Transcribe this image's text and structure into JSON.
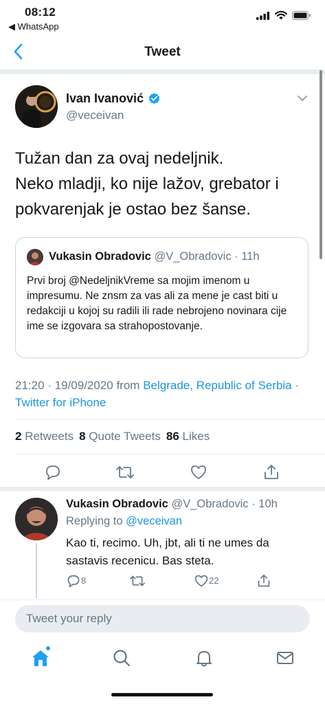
{
  "status": {
    "time": "08:12",
    "back_app": "◀ WhatsApp"
  },
  "nav": {
    "title": "Tweet",
    "back_icon": "chevron-left-icon"
  },
  "tweet": {
    "author_name": "Ivan Ivanović",
    "author_handle": "@veceivan",
    "verified": true,
    "text_lines": [
      "Tužan dan za ovaj nedeljnik.",
      "Neko mladji, ko nije lažov, grebator i",
      "pokvarenjak je ostao bez šanse."
    ],
    "quote": {
      "name": "Vukasin Obradovic",
      "handle": "@V_Obradovic",
      "time": "11h",
      "text": "Prvi broj @NedeljnikVreme sa mojim imenom u impresumu. Ne znsm za vas ali za mene je cast biti u redakciji u kojoj su radili ili rade nebrojeno novinara cije ime se izgovara sa strahopostovanje."
    },
    "timestamp": "21:20 · 19/09/2020 from ",
    "location": "Belgrade, Republic of Serbia",
    "separator": " · ",
    "source": "Twitter for iPhone",
    "stats": {
      "retweets_count": "2",
      "retweets_label": "Retweets",
      "quotes_count": "8",
      "quotes_label": "Quote Tweets",
      "likes_count": "86",
      "likes_label": "Likes"
    }
  },
  "reply": {
    "name": "Vukasin Obradovic",
    "handle": "@V_Obradovic",
    "time": "10h",
    "replying_prefix": "Replying to ",
    "replying_to": "@veceivan",
    "text": "Kao ti, recimo. Uh, jbt, ali ti ne umes da sastavis recenicu. Bas steta.",
    "reply_count": "8",
    "like_count": "22"
  },
  "compose": {
    "placeholder": "Tweet your reply"
  },
  "colors": {
    "accent": "#1da1f2",
    "link": "#1b95e0",
    "secondary_text": "#657786"
  }
}
